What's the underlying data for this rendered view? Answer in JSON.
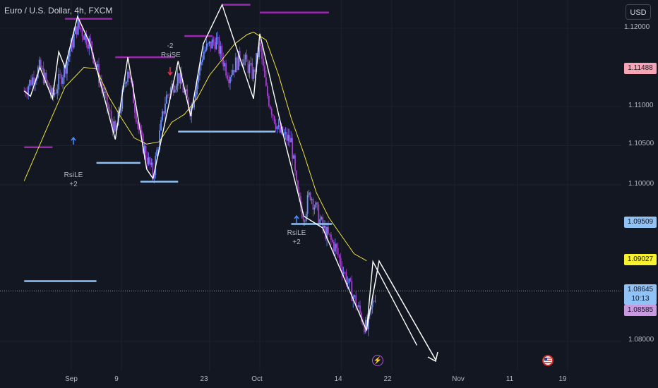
{
  "header": {
    "symbol_title": "Euro / U.S. Dollar, 4h, FXCM",
    "currency": "USD"
  },
  "price_axis": {
    "ticks": [
      {
        "label": "1.12000",
        "value": 1.12
      },
      {
        "label": "1.11000",
        "value": 1.11
      },
      {
        "label": "1.10500",
        "value": 1.105
      },
      {
        "label": "1.10000",
        "value": 1.1
      },
      {
        "label": "1.08000",
        "value": 1.08
      }
    ],
    "badges": [
      {
        "label": "1.11488",
        "value": 1.11488,
        "bg": "#f7a4b4",
        "fg": "#131722"
      },
      {
        "label": "1.09509",
        "value": 1.09509,
        "bg": "#90c2f5",
        "fg": "#131722"
      },
      {
        "label": "1.09027",
        "value": 1.09027,
        "bg": "#f8f12f",
        "fg": "#131722"
      }
    ],
    "current": {
      "price": "1.08645",
      "countdown": "10:13",
      "value": 1.08645
    },
    "lower_badge": {
      "label": "1.08585",
      "value": 1.08585
    }
  },
  "date_axis": {
    "ticks": [
      {
        "label": "Sep",
        "day": 0
      },
      {
        "label": "9",
        "day": 8
      },
      {
        "label": "23",
        "day": 22
      },
      {
        "label": "Oct",
        "day": 30
      },
      {
        "label": "14",
        "day": 43
      },
      {
        "label": "22",
        "day": 51
      },
      {
        "label": "Nov",
        "day": 61
      },
      {
        "label": "11",
        "day": 71
      },
      {
        "label": "19",
        "day": 79
      }
    ]
  },
  "annotations": {
    "rsise": {
      "count": "-2",
      "label": "RsiSE"
    },
    "rsile1": {
      "label": "RsiLE",
      "count": "+2"
    },
    "rsile2": {
      "label": "RsiLE",
      "count": "+2"
    }
  },
  "events": {
    "lightning": "lightning-icon",
    "flag": "us-flag-icon"
  },
  "colors": {
    "bg": "#131722",
    "grid": "#1e222d",
    "bull": "#6b8cff",
    "bear": "#a040c8",
    "zigzag": "#ffffff",
    "ma": "#f0e442",
    "resistance": "#9c27b0",
    "support": "#90c2f5"
  },
  "chart_data": {
    "type": "line",
    "x_unit": "days since Sep 1",
    "ylim": [
      1.0775,
      1.1225
    ],
    "xlim": [
      -7.5,
      96
    ],
    "zigzag": [
      [
        -7.5,
        1.112
      ],
      [
        -6.5,
        1.1113
      ],
      [
        -5,
        1.115
      ],
      [
        -3,
        1.111
      ],
      [
        -2,
        1.117
      ],
      [
        -1,
        1.115
      ],
      [
        1,
        1.1215
      ],
      [
        3,
        1.118
      ],
      [
        7,
        1.1058
      ],
      [
        9,
        1.1163
      ],
      [
        12,
        1.102
      ],
      [
        13,
        1.1008
      ],
      [
        17,
        1.1158
      ],
      [
        19,
        1.1088
      ],
      [
        21,
        1.118
      ],
      [
        24,
        1.123
      ],
      [
        29,
        1.111
      ],
      [
        30,
        1.1193
      ],
      [
        34,
        1.1055
      ],
      [
        37,
        1.096
      ],
      [
        40,
        1.0945
      ],
      [
        47,
        1.0814
      ],
      [
        48,
        1.0902
      ],
      [
        55,
        1.0795
      ]
    ],
    "moving_average": [
      [
        -7.5,
        1.1005
      ],
      [
        -4,
        1.107
      ],
      [
        -1,
        1.1125
      ],
      [
        2,
        1.115
      ],
      [
        4,
        1.1148
      ],
      [
        6,
        1.1112
      ],
      [
        8,
        1.1085
      ],
      [
        10,
        1.106
      ],
      [
        12,
        1.1052
      ],
      [
        14,
        1.1055
      ],
      [
        16,
        1.108
      ],
      [
        18,
        1.109
      ],
      [
        20,
        1.111
      ],
      [
        22,
        1.114
      ],
      [
        24,
        1.116
      ],
      [
        26,
        1.118
      ],
      [
        28,
        1.1192
      ],
      [
        29,
        1.1195
      ],
      [
        31,
        1.1185
      ],
      [
        33,
        1.114
      ],
      [
        35,
        1.1085
      ],
      [
        37,
        1.104
      ],
      [
        39,
        1.099
      ],
      [
        41,
        1.0958
      ],
      [
        43,
        1.0935
      ],
      [
        45,
        1.0912
      ],
      [
        47,
        1.0903
      ]
    ],
    "resistance_lines": [
      [
        -7.5,
        -3,
        1.1048
      ],
      [
        -1,
        6.5,
        1.1212
      ],
      [
        7,
        16.5,
        1.1163
      ],
      [
        18,
        22.5,
        1.119
      ],
      [
        24,
        28.5,
        1.123
      ],
      [
        30,
        41,
        1.122
      ]
    ],
    "support_lines": [
      [
        -7.5,
        4,
        1.0877
      ],
      [
        4,
        11,
        1.1028
      ],
      [
        11,
        17,
        1.1004
      ],
      [
        17,
        32.5,
        1.1068
      ],
      [
        35,
        41.5,
        1.095
      ]
    ],
    "price_path": [
      [
        -7.5,
        1.112
      ],
      [
        -5,
        1.115
      ],
      [
        -3,
        1.1112
      ],
      [
        -1,
        1.115
      ],
      [
        1,
        1.1205
      ],
      [
        3,
        1.118
      ],
      [
        5,
        1.112
      ],
      [
        7,
        1.1065
      ],
      [
        9,
        1.115
      ],
      [
        11,
        1.106
      ],
      [
        13,
        1.1012
      ],
      [
        15,
        1.111
      ],
      [
        17,
        1.114
      ],
      [
        19,
        1.1095
      ],
      [
        21,
        1.117
      ],
      [
        23,
        1.1185
      ],
      [
        25,
        1.114
      ],
      [
        27,
        1.1165
      ],
      [
        29,
        1.114
      ],
      [
        30,
        1.118
      ],
      [
        31,
        1.112
      ],
      [
        33,
        1.1068
      ],
      [
        35,
        1.1055
      ],
      [
        36,
        1.0985
      ],
      [
        37,
        1.096
      ],
      [
        38,
        1.099
      ],
      [
        40,
        1.0945
      ],
      [
        42,
        1.092
      ],
      [
        44,
        1.0875
      ],
      [
        46,
        1.0835
      ],
      [
        47,
        1.0814
      ],
      [
        48,
        1.085
      ],
      [
        48.5,
        1.0864
      ]
    ]
  }
}
